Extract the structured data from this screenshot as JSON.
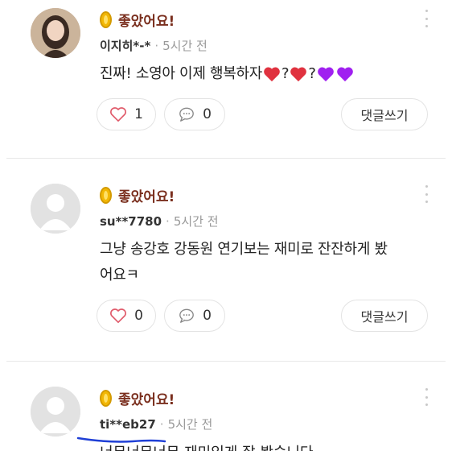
{
  "comments": [
    {
      "avatar": "photo-avatar",
      "reaction_icon": "gold-coin-icon",
      "reaction_label": "좋았어요!",
      "username": "이지히*-*",
      "time": "5시간 전",
      "text": "진짜! 소영아 이제 행복하자",
      "emoji_tail": [
        "❤",
        "?",
        "❤",
        "?",
        "💜",
        "💜"
      ],
      "likes": "1",
      "replies": "0",
      "reply_button": "댓글쓰기"
    },
    {
      "avatar": "default-avatar",
      "reaction_icon": "gold-coin-icon",
      "reaction_label": "좋았어요!",
      "username": "su**7780",
      "time": "5시간 전",
      "text_line1": "그냥 송강호 강동원 연기보는 재미로 잔잔하게 봤",
      "text_line2": "어요ㅋ",
      "likes": "0",
      "replies": "0",
      "reply_button": "댓글쓰기"
    },
    {
      "avatar": "default-avatar",
      "reaction_icon": "gold-coin-icon",
      "reaction_label": "좋았어요!",
      "username": "ti**eb27",
      "time": "5시간 전",
      "text_partial": "너무너무너무 재미있게 잘 봤습니다"
    }
  ],
  "separator": "·",
  "colors": {
    "reaction": "#7a2f1e",
    "heart_outline": "#e05a6a",
    "heart_fill": "#e0323f",
    "purple_heart": "#a020f0",
    "annotation_underline": "#1f3fd6"
  }
}
